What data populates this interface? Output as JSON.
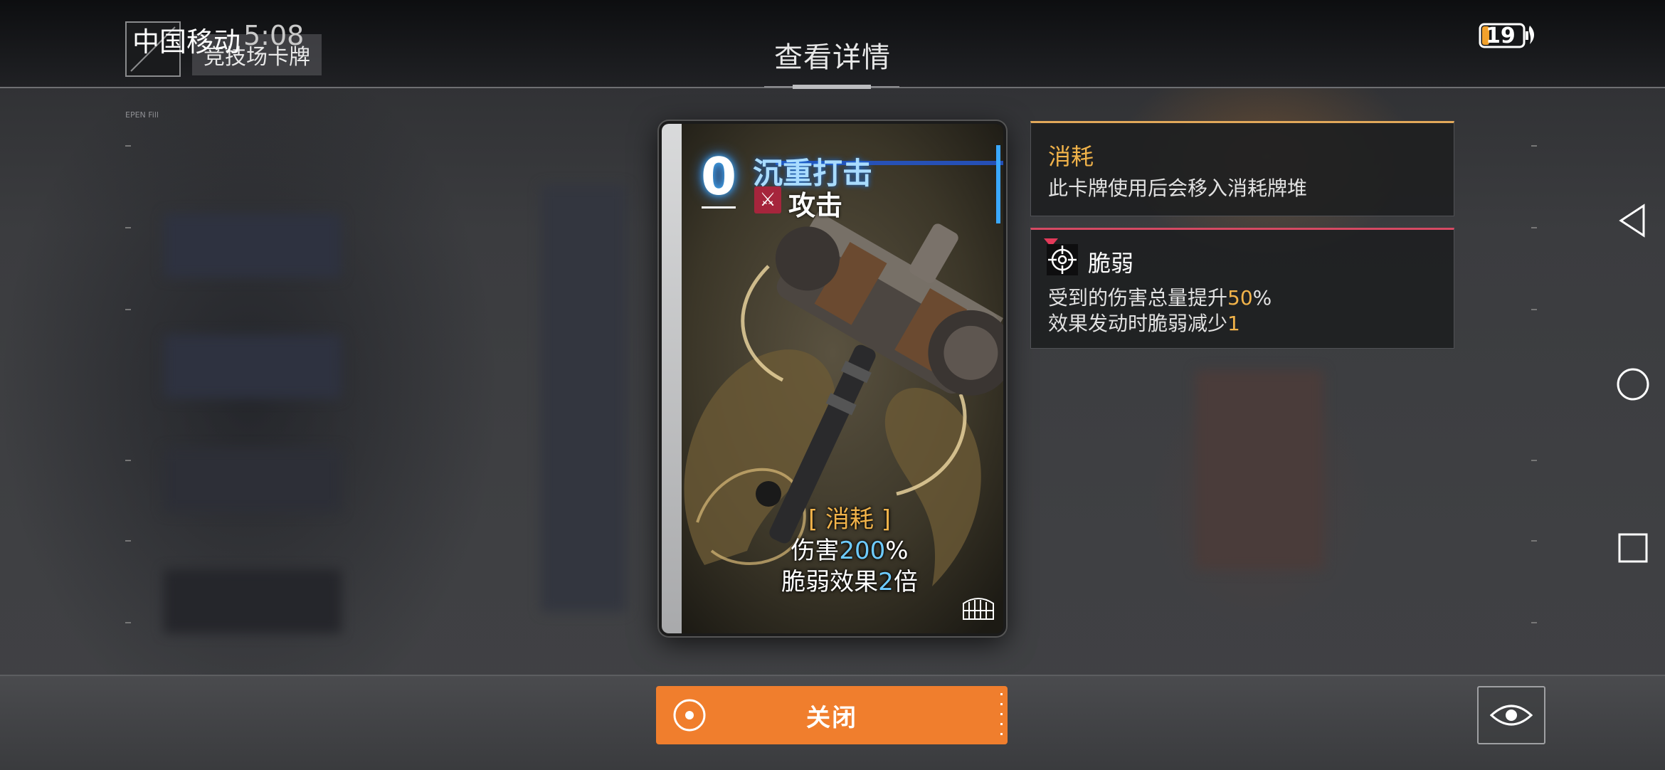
{
  "status_bar": {
    "carrier": "中国移动",
    "time": "5:08",
    "battery_level": "19"
  },
  "header": {
    "title": "查看详情",
    "context_tab": "竞技场卡牌",
    "panel_tag": "EPEN Fill"
  },
  "card": {
    "cost": "0",
    "name": "沉重打击",
    "type": "攻击",
    "exhaust_tag": "[ 消耗 ]",
    "damage_prefix": "伤害",
    "damage_value": "200",
    "damage_suffix": "%",
    "vulnerable_prefix": "脆弱效果",
    "vulnerable_value": "2",
    "vulnerable_suffix": "倍"
  },
  "keywords": [
    {
      "title": "消耗",
      "description": "此卡牌使用后会移入消耗牌堆",
      "accent": "#e1a85a"
    },
    {
      "title": "脆弱",
      "line1_prefix": "受到的伤害总量提升",
      "line1_value": "50",
      "line1_suffix": "%",
      "line2_prefix": "效果发动时脆弱减少",
      "line2_value": "1",
      "accent": "#d64a63"
    }
  ],
  "actions": {
    "close_label": "关闭"
  },
  "colors": {
    "primary_button": "#f07e2d",
    "highlight_blue": "#6ecbff",
    "highlight_orange": "#f1b34a"
  },
  "icons": [
    "crossed-swords-icon",
    "crosshair-icon",
    "eye-icon",
    "back-triangle-icon",
    "home-circle-icon",
    "recents-square-icon",
    "colosseum-icon"
  ]
}
